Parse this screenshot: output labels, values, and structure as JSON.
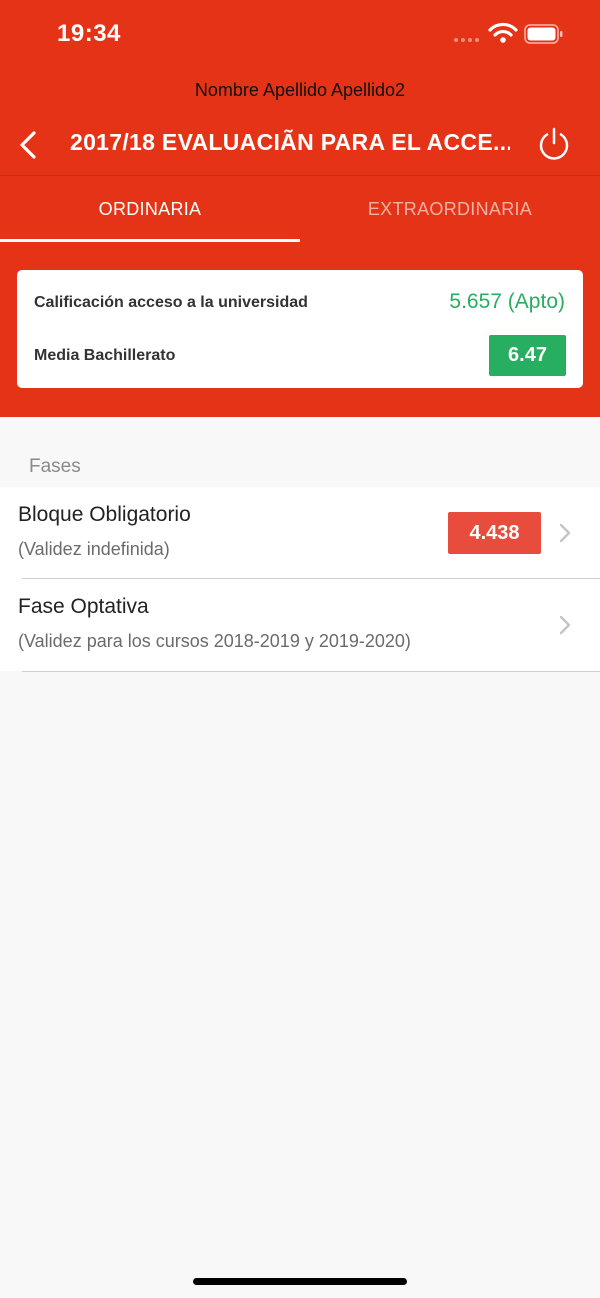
{
  "status_bar": {
    "time": "19:34"
  },
  "header": {
    "user_name": "Nombre Apellido Apellido2",
    "title": "2017/18 EVALUACIÃN PARA EL ACCE..."
  },
  "tabs": [
    {
      "label": "ORDINARIA",
      "selected": true
    },
    {
      "label": "EXTRAORDINARIA",
      "selected": false
    }
  ],
  "summary": {
    "access_label": "Calificación acceso a la universidad",
    "access_value": "5.657 (Apto)",
    "media_label": "Media Bachillerato",
    "media_value": "6.47"
  },
  "phases": {
    "section_title": "Fases",
    "items": [
      {
        "title": "Bloque Obligatorio",
        "subtitle": "(Validez indefinida)",
        "grade": "4.438"
      },
      {
        "title": "Fase Optativa",
        "subtitle": "(Validez para los cursos 2018-2019 y 2019-2020)"
      }
    ]
  },
  "colors": {
    "brand_red": "#e43317",
    "grade_pass_green": "#27ae60",
    "grade_fail_red": "#e74c3c"
  },
  "icons": {
    "back": "back-chevron-icon",
    "power": "power-icon",
    "wifi": "wifi-icon",
    "battery": "battery-icon",
    "row_chevron": "chevron-right-icon"
  }
}
